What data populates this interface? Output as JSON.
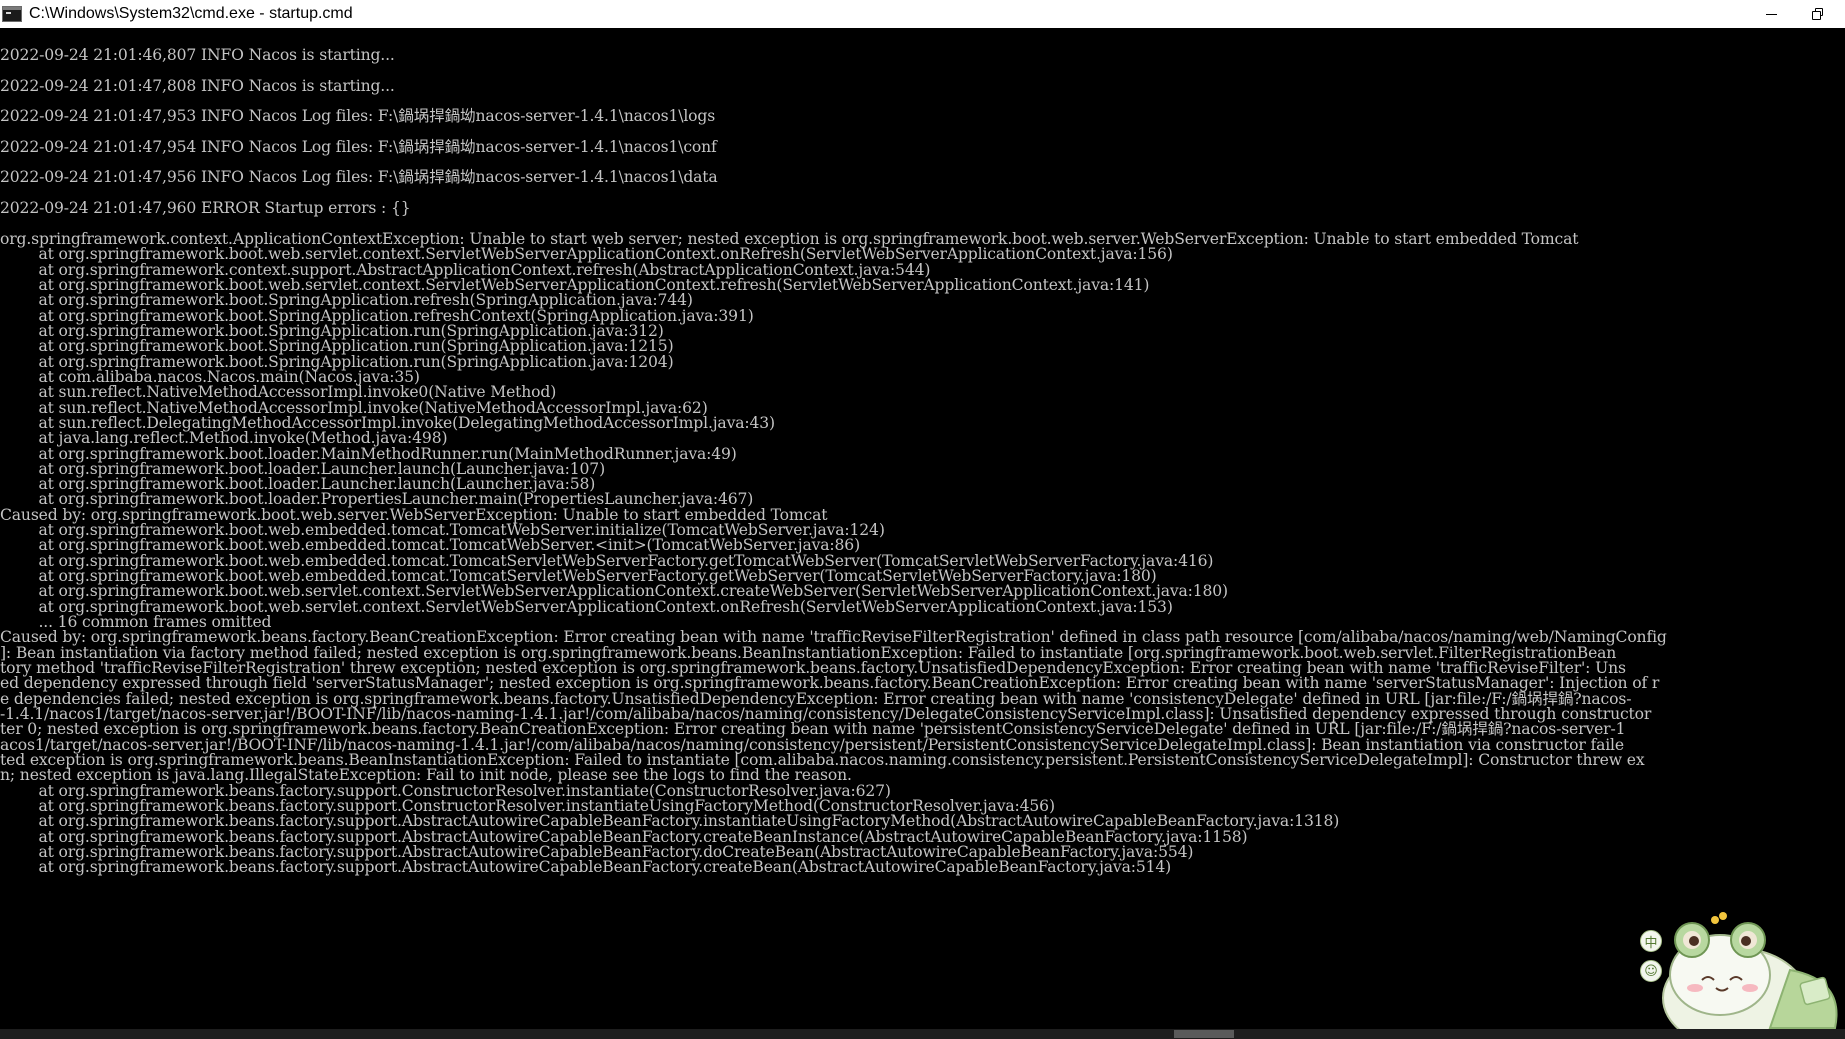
{
  "window": {
    "title": "C:\\Windows\\System32\\cmd.exe - startup.cmd"
  },
  "ime": {
    "mode_label": "中",
    "emoji_label": "☺"
  },
  "console": {
    "lines": [
      "2022-09-24 21:01:46,807 INFO Nacos is starting...",
      "",
      "2022-09-24 21:01:47,808 INFO Nacos is starting...",
      "",
      "2022-09-24 21:01:47,953 INFO Nacos Log files: F:\\鍋埚捍鍋坳nacos-server-1.4.1\\nacos1\\logs",
      "",
      "2022-09-24 21:01:47,954 INFO Nacos Log files: F:\\鍋埚捍鍋坳nacos-server-1.4.1\\nacos1\\conf",
      "",
      "2022-09-24 21:01:47,956 INFO Nacos Log files: F:\\鍋埚捍鍋坳nacos-server-1.4.1\\nacos1\\data",
      "",
      "2022-09-24 21:01:47,960 ERROR Startup errors : {}",
      "",
      "org.springframework.context.ApplicationContextException: Unable to start web server; nested exception is org.springframework.boot.web.server.WebServerException: Unable to start embedded Tomcat",
      "        at org.springframework.boot.web.servlet.context.ServletWebServerApplicationContext.onRefresh(ServletWebServerApplicationContext.java:156)",
      "        at org.springframework.context.support.AbstractApplicationContext.refresh(AbstractApplicationContext.java:544)",
      "        at org.springframework.boot.web.servlet.context.ServletWebServerApplicationContext.refresh(ServletWebServerApplicationContext.java:141)",
      "        at org.springframework.boot.SpringApplication.refresh(SpringApplication.java:744)",
      "        at org.springframework.boot.SpringApplication.refreshContext(SpringApplication.java:391)",
      "        at org.springframework.boot.SpringApplication.run(SpringApplication.java:312)",
      "        at org.springframework.boot.SpringApplication.run(SpringApplication.java:1215)",
      "        at org.springframework.boot.SpringApplication.run(SpringApplication.java:1204)",
      "        at com.alibaba.nacos.Nacos.main(Nacos.java:35)",
      "        at sun.reflect.NativeMethodAccessorImpl.invoke0(Native Method)",
      "        at sun.reflect.NativeMethodAccessorImpl.invoke(NativeMethodAccessorImpl.java:62)",
      "        at sun.reflect.DelegatingMethodAccessorImpl.invoke(DelegatingMethodAccessorImpl.java:43)",
      "        at java.lang.reflect.Method.invoke(Method.java:498)",
      "        at org.springframework.boot.loader.MainMethodRunner.run(MainMethodRunner.java:49)",
      "        at org.springframework.boot.loader.Launcher.launch(Launcher.java:107)",
      "        at org.springframework.boot.loader.Launcher.launch(Launcher.java:58)",
      "        at org.springframework.boot.loader.PropertiesLauncher.main(PropertiesLauncher.java:467)",
      "Caused by: org.springframework.boot.web.server.WebServerException: Unable to start embedded Tomcat",
      "        at org.springframework.boot.web.embedded.tomcat.TomcatWebServer.initialize(TomcatWebServer.java:124)",
      "        at org.springframework.boot.web.embedded.tomcat.TomcatWebServer.<init>(TomcatWebServer.java:86)",
      "        at org.springframework.boot.web.embedded.tomcat.TomcatServletWebServerFactory.getTomcatWebServer(TomcatServletWebServerFactory.java:416)",
      "        at org.springframework.boot.web.embedded.tomcat.TomcatServletWebServerFactory.getWebServer(TomcatServletWebServerFactory.java:180)",
      "        at org.springframework.boot.web.servlet.context.ServletWebServerApplicationContext.createWebServer(ServletWebServerApplicationContext.java:180)",
      "        at org.springframework.boot.web.servlet.context.ServletWebServerApplicationContext.onRefresh(ServletWebServerApplicationContext.java:153)",
      "        ... 16 common frames omitted",
      "Caused by: org.springframework.beans.factory.BeanCreationException: Error creating bean with name 'trafficReviseFilterRegistration' defined in class path resource [com/alibaba/nacos/naming/web/NamingConfig",
      "]: Bean instantiation via factory method failed; nested exception is org.springframework.beans.BeanInstantiationException: Failed to instantiate [org.springframework.boot.web.servlet.FilterRegistrationBean",
      "tory method 'trafficReviseFilterRegistration' threw exception; nested exception is org.springframework.beans.factory.UnsatisfiedDependencyException: Error creating bean with name 'trafficReviseFilter': Uns",
      "ed dependency expressed through field 'serverStatusManager'; nested exception is org.springframework.beans.factory.BeanCreationException: Error creating bean with name 'serverStatusManager': Injection of r",
      "e dependencies failed; nested exception is org.springframework.beans.factory.UnsatisfiedDependencyException: Error creating bean with name 'consistencyDelegate' defined in URL [jar:file:/F:/鍋埚捍鍋?nacos-",
      "-1.4.1/nacos1/target/nacos-server.jar!/BOOT-INF/lib/nacos-naming-1.4.1.jar!/com/alibaba/nacos/naming/consistency/DelegateConsistencyServiceImpl.class]: Unsatisfied dependency expressed through constructor",
      "ter 0; nested exception is org.springframework.beans.factory.BeanCreationException: Error creating bean with name 'persistentConsistencyServiceDelegate' defined in URL [jar:file:/F:/鍋埚捍鍋?nacos-server-1",
      "acos1/target/nacos-server.jar!/BOOT-INF/lib/nacos-naming-1.4.1.jar!/com/alibaba/nacos/naming/consistency/persistent/PersistentConsistencyServiceDelegateImpl.class]: Bean instantiation via constructor faile",
      "ted exception is org.springframework.beans.BeanInstantiationException: Failed to instantiate [com.alibaba.nacos.naming.consistency.persistent.PersistentConsistencyServiceDelegateImpl]: Constructor threw ex",
      "n; nested exception is java.lang.IllegalStateException: Fail to init node, please see the logs to find the reason.",
      "        at org.springframework.beans.factory.support.ConstructorResolver.instantiate(ConstructorResolver.java:627)",
      "        at org.springframework.beans.factory.support.ConstructorResolver.instantiateUsingFactoryMethod(ConstructorResolver.java:456)",
      "        at org.springframework.beans.factory.support.AbstractAutowireCapableBeanFactory.instantiateUsingFactoryMethod(AbstractAutowireCapableBeanFactory.java:1318)",
      "        at org.springframework.beans.factory.support.AbstractAutowireCapableBeanFactory.createBeanInstance(AbstractAutowireCapableBeanFactory.java:1158)",
      "        at org.springframework.beans.factory.support.AbstractAutowireCapableBeanFactory.doCreateBean(AbstractAutowireCapableBeanFactory.java:554)",
      "        at org.springframework.beans.factory.support.AbstractAutowireCapableBeanFactory.createBean(AbstractAutowireCapableBeanFactory.java:514)"
    ]
  }
}
